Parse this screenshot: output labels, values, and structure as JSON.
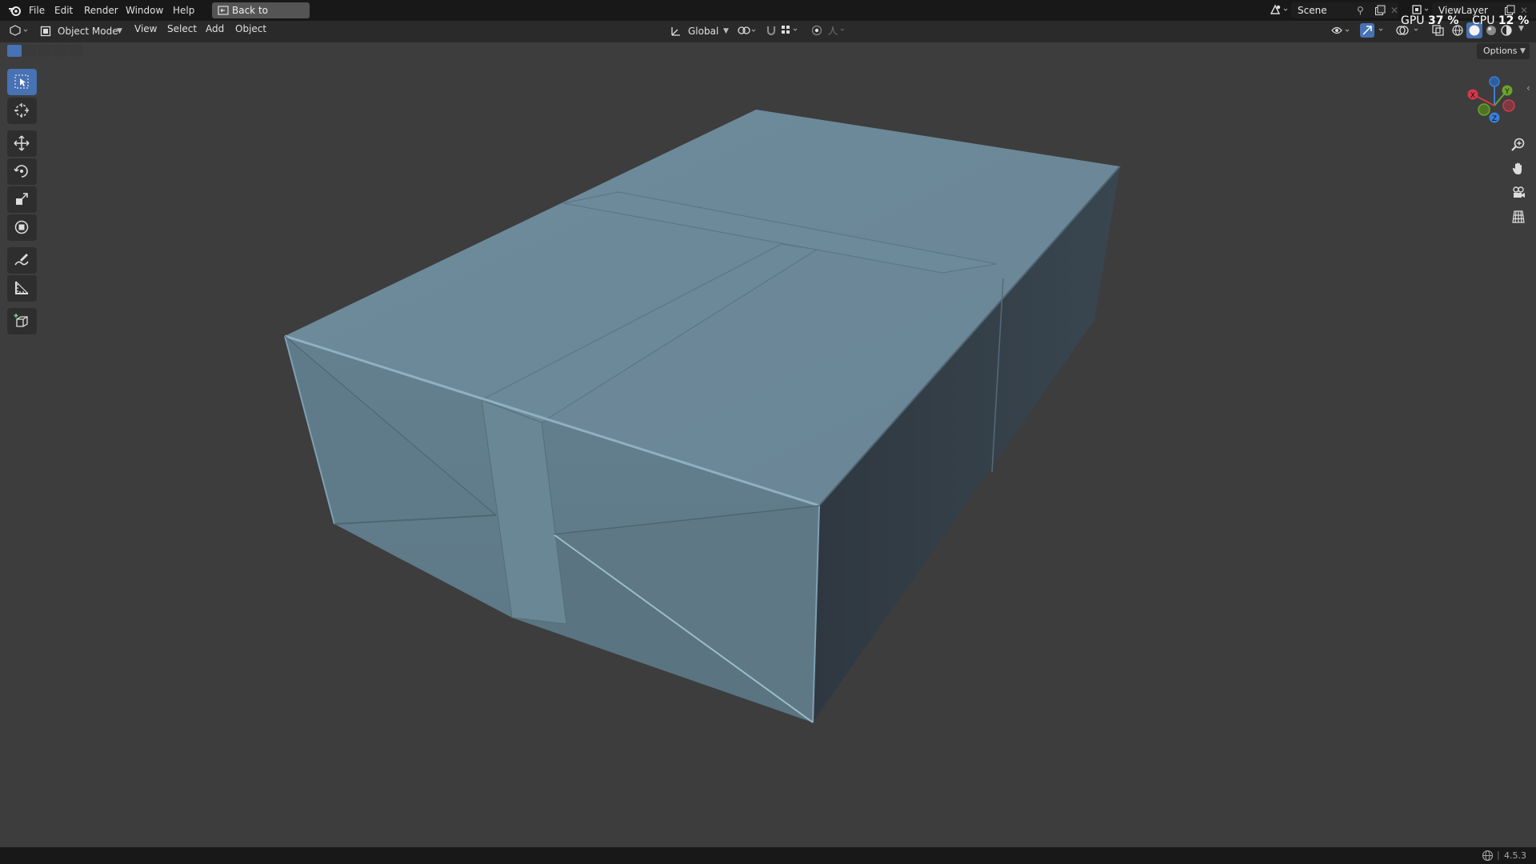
{
  "menu": [
    "File",
    "Edit",
    "Render",
    "Window",
    "Help"
  ],
  "back_button": "Back to Previous",
  "scene": {
    "name": "Scene"
  },
  "view_layer": {
    "name": "ViewLayer"
  },
  "stats": {
    "gpu_label": "GPU",
    "gpu_value": "37 %",
    "cpu_label": "CPU",
    "cpu_value": "12 %"
  },
  "header": {
    "mode": "Object Mode",
    "menus": [
      "View",
      "Select",
      "Add",
      "Object"
    ],
    "transform_orientation": "Global"
  },
  "options_label": "Options",
  "gizmo": {
    "x": "X",
    "y": "Y",
    "z": "Z"
  },
  "toolbar": [
    "select-box",
    "cursor",
    "move",
    "rotate",
    "scale",
    "transform",
    "annotate",
    "measure",
    "add-cube"
  ],
  "status": {
    "version": "4.5.3"
  },
  "colors": {
    "accent": "#4772b3",
    "background": "#3d3d3d",
    "mesh": "#6b8797"
  }
}
